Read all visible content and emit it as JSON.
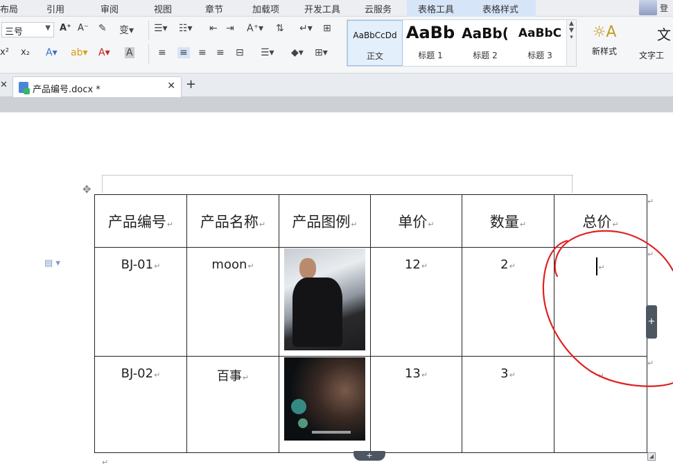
{
  "menu": {
    "tabs": [
      "布局",
      "引用",
      "审阅",
      "视图",
      "章节",
      "加载项",
      "开发工具",
      "云服务",
      "表格工具",
      "表格样式"
    ],
    "corner_text": "登"
  },
  "ribbon": {
    "font_size": "三号",
    "grow_font": "A⁺",
    "shrink_font": "A⁻",
    "superscript": "x²",
    "subscript": "x₂",
    "styles": [
      {
        "sample": "AaBbCcDd",
        "label": "正文"
      },
      {
        "sample": "AaBb",
        "label": "标题 1"
      },
      {
        "sample": "AaBb(",
        "label": "标题 2"
      },
      {
        "sample": "AaBbC",
        "label": "标题 3"
      }
    ],
    "new_style": "新样式",
    "text_tools": "文字工"
  },
  "document_tab": {
    "name": "产品编号.docx *"
  },
  "table": {
    "headers": [
      "产品编号",
      "产品名称",
      "产品图例",
      "单价",
      "数量",
      "总价"
    ],
    "rows": [
      {
        "code": "BJ-01",
        "name": "moon",
        "price": "12",
        "qty": "2",
        "total": ""
      },
      {
        "code": "BJ-02",
        "name": "百事",
        "price": "13",
        "qty": "3",
        "total": ""
      }
    ]
  },
  "colors": {
    "annotation": "#e02020",
    "table_tools_highlight": "#d7e5f8"
  }
}
